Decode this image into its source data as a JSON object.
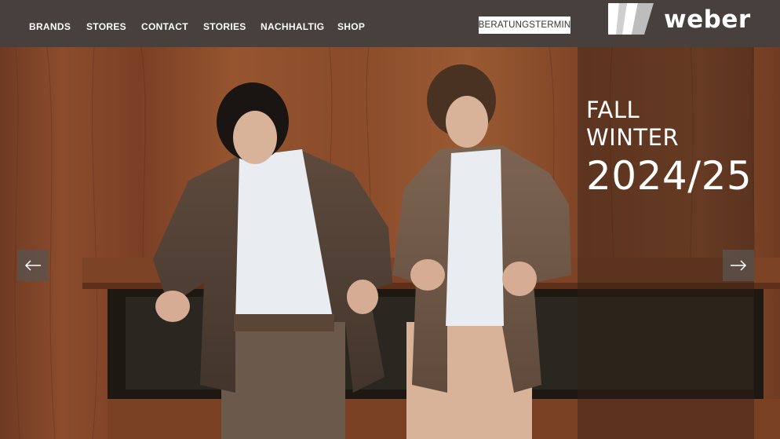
{
  "header": {
    "nav": [
      "BRANDS",
      "STORES",
      "CONTACT",
      "STORIES",
      "NACHHALTIG",
      "SHOP"
    ],
    "cta_label": "BERATUNGSTERMIN",
    "logo_text": "weber",
    "logo_icon": "weber-w-logo-icon"
  },
  "hero": {
    "headline": {
      "line1": "FALL",
      "line2": "WINTER",
      "line3": "2024/25"
    },
    "prev_icon": "arrow-left-icon",
    "next_icon": "arrow-right-icon"
  },
  "colors": {
    "header_bg": "#47403c",
    "wood": "#8a4a2c",
    "overlay": "#301e16"
  }
}
